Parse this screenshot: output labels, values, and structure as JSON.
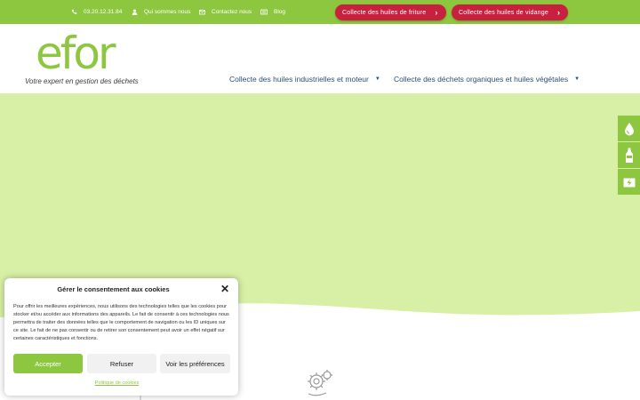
{
  "topbar": {
    "phone": "03.20.12.31.84",
    "about": "Qui sommes nous",
    "contact": "Contactez nous",
    "blog": "Blog",
    "cta_frying": "Collecte des huiles de friture",
    "cta_draining": "Collecte des huiles de vidange"
  },
  "header": {
    "logo_text": "efor",
    "tagline": "Votre expert en gestion des déchets",
    "nav": [
      {
        "label": "Collecte des huiles industrielles et moteur"
      },
      {
        "label": "Collecte des déchets organiques et huiles végétales"
      }
    ]
  },
  "side_icons": [
    "oil-drop-icon",
    "bottle-icon",
    "battery-icon"
  ],
  "cookie": {
    "title": "Gérer le consentement aux cookies",
    "text": "Pour offrir les meilleures expériences, nous utilisons des technologies telles que les cookies pour stocker et/ou accéder aux informations des appareils. Le fait de consentir à ces technologies nous permettra de traiter des données telles que le comportement de navigation ou les ID uniques sur ce site. Le fait de ne pas consentir ou de retirer son consentement peut avoir un effet négatif sur certaines caractéristiques et fonctions.",
    "accept": "Accepter",
    "refuse": "Refuser",
    "prefs": "Voir les préférences",
    "policy": "Politique de cookies"
  },
  "colors": {
    "brand_green": "#8dc63f",
    "hero_green": "#d8f0a6",
    "cta_red": "#c8213f",
    "nav_blue": "#2b4e7a"
  }
}
